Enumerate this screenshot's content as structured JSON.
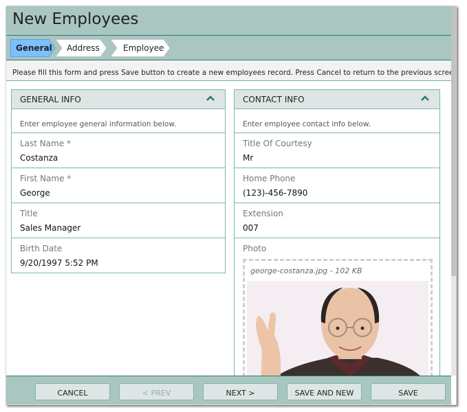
{
  "page": {
    "title": "New Employees"
  },
  "steps": [
    {
      "label": "General",
      "active": true
    },
    {
      "label": "Address",
      "active": false
    },
    {
      "label": "Employee",
      "active": false
    }
  ],
  "description": "Please fill this form and press Save button to create a new employees record. Press Cancel to return to the previous screen.",
  "general_info": {
    "title": "GENERAL INFO",
    "description": "Enter employee general information below.",
    "fields": [
      {
        "label": "Last Name *",
        "value": "Costanza"
      },
      {
        "label": "First Name *",
        "value": "George"
      },
      {
        "label": "Title",
        "value": "Sales Manager"
      },
      {
        "label": "Birth Date",
        "value": "9/20/1997 5:52 PM"
      }
    ]
  },
  "contact_info": {
    "title": "CONTACT INFO",
    "description": "Enter employee contact info below.",
    "fields": [
      {
        "label": "Title Of Courtesy",
        "value": "Mr"
      },
      {
        "label": "Home Phone",
        "value": "(123)-456-7890"
      },
      {
        "label": "Extension",
        "value": "007"
      }
    ],
    "photo": {
      "label": "Photo",
      "caption": "george-costanza.jpg - 102 KB"
    }
  },
  "buttons": {
    "cancel": "CANCEL",
    "prev": "< PREV",
    "next": "NEXT >",
    "save_and_new": "SAVE AND NEW",
    "save": "SAVE"
  },
  "colors": {
    "header_bg": "#a9c6c1",
    "accent_line": "#2d7a6c",
    "active_step": "#7dbfff",
    "panel_border": "#7fb5ad"
  }
}
